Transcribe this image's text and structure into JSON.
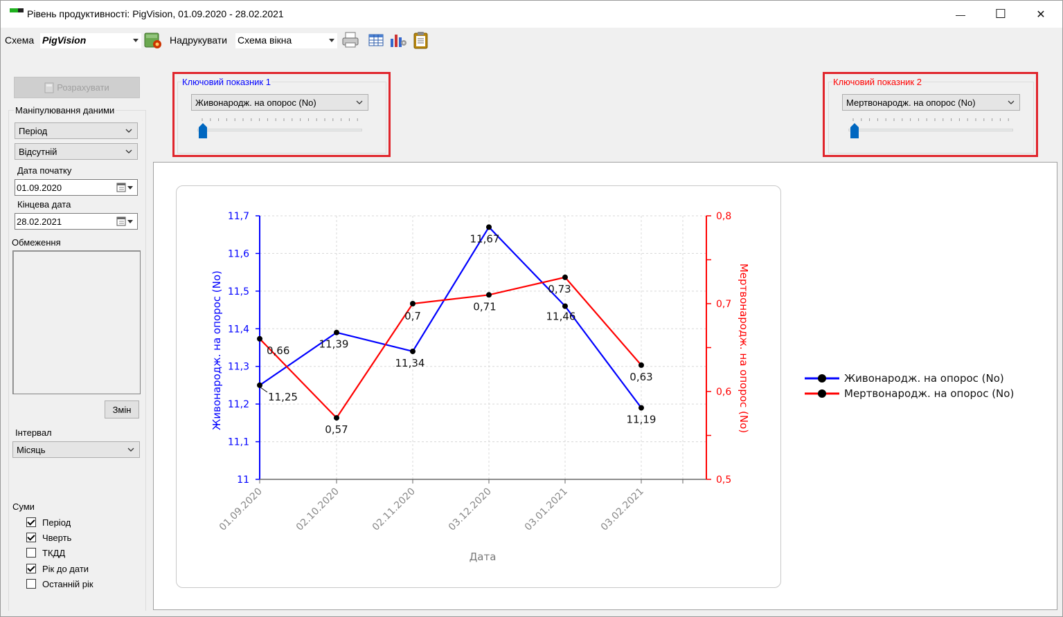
{
  "window": {
    "title": "Рівень продуктивності: PigVision, 01.09.2020 - 28.02.2021",
    "min_glyph": "—",
    "max_glyph": "☐",
    "close_glyph": "✕"
  },
  "toolbar": {
    "schema_label": "Схема",
    "schema_value": "PigVision",
    "print_label": "Надрукувати",
    "print_value": "Схема вікна",
    "icons": [
      "schema-settings-icon",
      "printer-icon",
      "table-icon",
      "chart-export-icon",
      "clipboard-icon"
    ]
  },
  "left_panel": {
    "calculate_button": "Розрахувати",
    "data_manipulation_label": "Маніпулювання даними",
    "period_select": "Період",
    "absent_select": "Відсутній",
    "start_date_label": "Дата початку",
    "start_date_value": "01.09.2020",
    "end_date_label": "Кінцева дата",
    "end_date_value": "28.02.2021",
    "restrictions_label": "Обмеження",
    "change_button": "Змін",
    "interval_label": "Інтервал",
    "interval_value": "Місяць",
    "sums_label": "Суми",
    "checkboxes": [
      {
        "label": "Період",
        "checked": true
      },
      {
        "label": "Чверть",
        "checked": true
      },
      {
        "label": "ТКДД",
        "checked": false
      },
      {
        "label": "Рік до дати",
        "checked": true
      },
      {
        "label": "Останній рік",
        "checked": false
      }
    ]
  },
  "key_indicator_1": {
    "title": "Ключовий показник 1",
    "title_color": "#0000ff",
    "value": "Живонародж. на опорос (No)",
    "slider_level": 0
  },
  "key_indicator_2": {
    "title": "Ключовий показник 2",
    "title_color": "#ff0000",
    "value": "Мертвонародж. на опорос (No)",
    "slider_level": 0
  },
  "chart_data": {
    "type": "line",
    "x": [
      "01.09.2020",
      "02.10.2020",
      "02.11.2020",
      "03.12.2020",
      "03.01.2021",
      "03.02.2021"
    ],
    "xlabel": "Дата",
    "series": [
      {
        "name": "Живонародж. на опорос (No)",
        "color": "#0000ff",
        "axis": "left",
        "values": [
          11.25,
          11.39,
          11.34,
          11.67,
          11.46,
          11.19
        ],
        "labels": [
          "11,25",
          "11,39",
          "11,34",
          "11,67",
          "11,46",
          "11,19"
        ]
      },
      {
        "name": "Мертвонародж. на опорос (No)",
        "color": "#ff0000",
        "axis": "right",
        "values": [
          0.66,
          0.57,
          0.7,
          0.71,
          0.73,
          0.63
        ],
        "labels": [
          "0,66",
          "0,57",
          "0,7",
          "0,71",
          "0,73",
          "0,63"
        ]
      }
    ],
    "y_left": {
      "label": "Живонародж. на опорос (No)",
      "min": 11,
      "max": 11.7,
      "ticks": [
        "11",
        "11,1",
        "11,2",
        "11,3",
        "11,4",
        "11,5",
        "11,6",
        "11,7"
      ]
    },
    "y_right": {
      "label": "Мертвонародж. на опорос (No)",
      "min": 0.5,
      "max": 0.8,
      "ticks": [
        "0,5",
        "0,6",
        "0,7",
        "0,8"
      ]
    },
    "grid": true,
    "legend_position": "right"
  }
}
